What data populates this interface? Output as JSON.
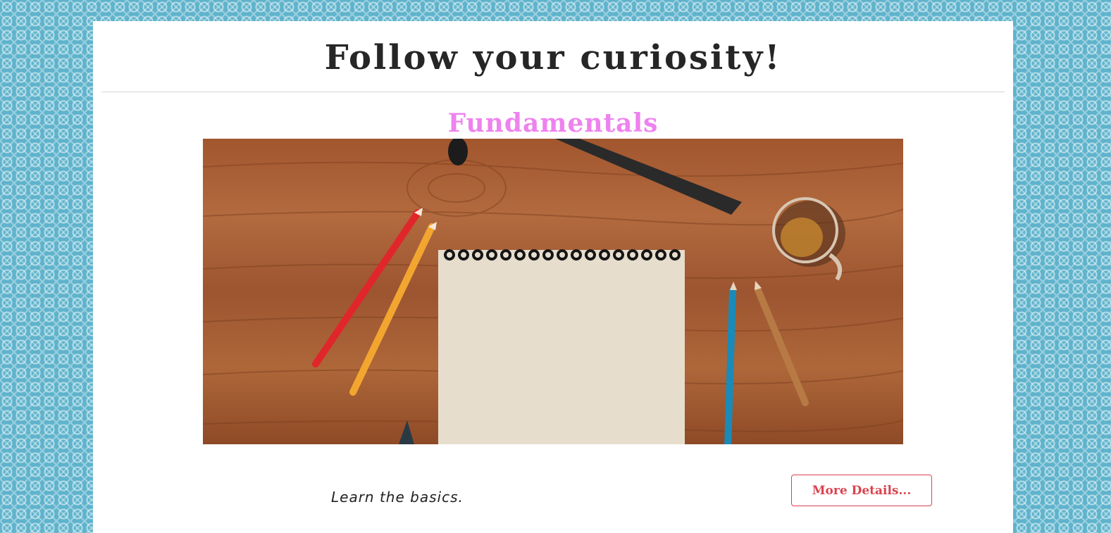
{
  "header": {
    "title": "Follow your curiosity!"
  },
  "section": {
    "title": "Fundamentals",
    "tagline": "Learn the basics.",
    "button_label": "More Details..."
  },
  "colors": {
    "page_background": "#5fb3cc",
    "card_background": "#ffffff",
    "title_text": "#262626",
    "section_title": "#ee82ee",
    "button_accent": "#d9434f"
  },
  "icons": {
    "hero_image": "desk-sketchbook-pencils-photo"
  }
}
